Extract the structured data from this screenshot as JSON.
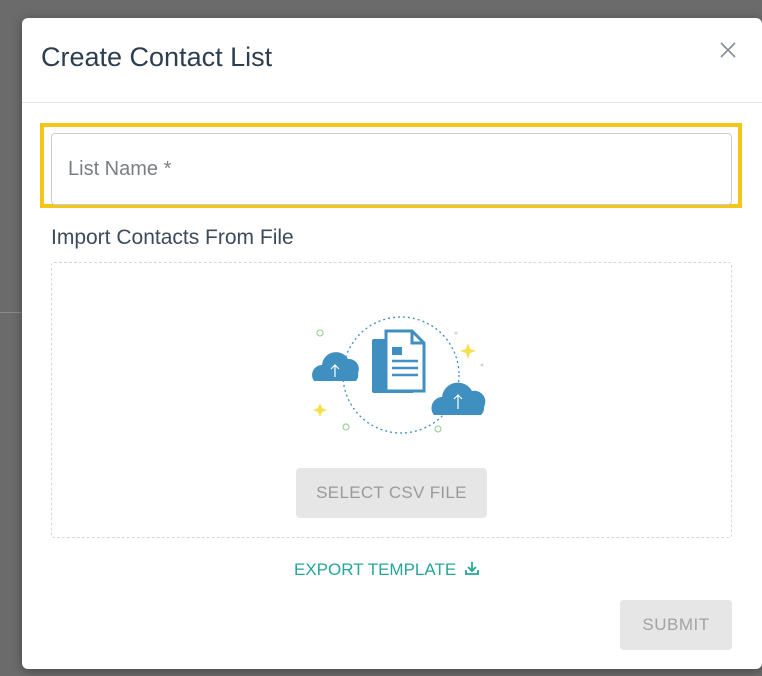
{
  "dialog": {
    "title": "Create Contact List",
    "close_icon": "close-icon"
  },
  "form": {
    "list_name": {
      "placeholder": "List Name *",
      "value": ""
    },
    "import_label": "Import Contacts From File",
    "select_csv_label": "SELECT CSV FILE",
    "export_template_label": "EXPORT TEMPLATE",
    "export_icon": "download-icon",
    "submit_label": "SUBMIT"
  },
  "colors": {
    "highlight": "#f5c518",
    "accent": "#26a69a",
    "cloud": "#3f8fc0",
    "title_text": "#2c3e50"
  }
}
